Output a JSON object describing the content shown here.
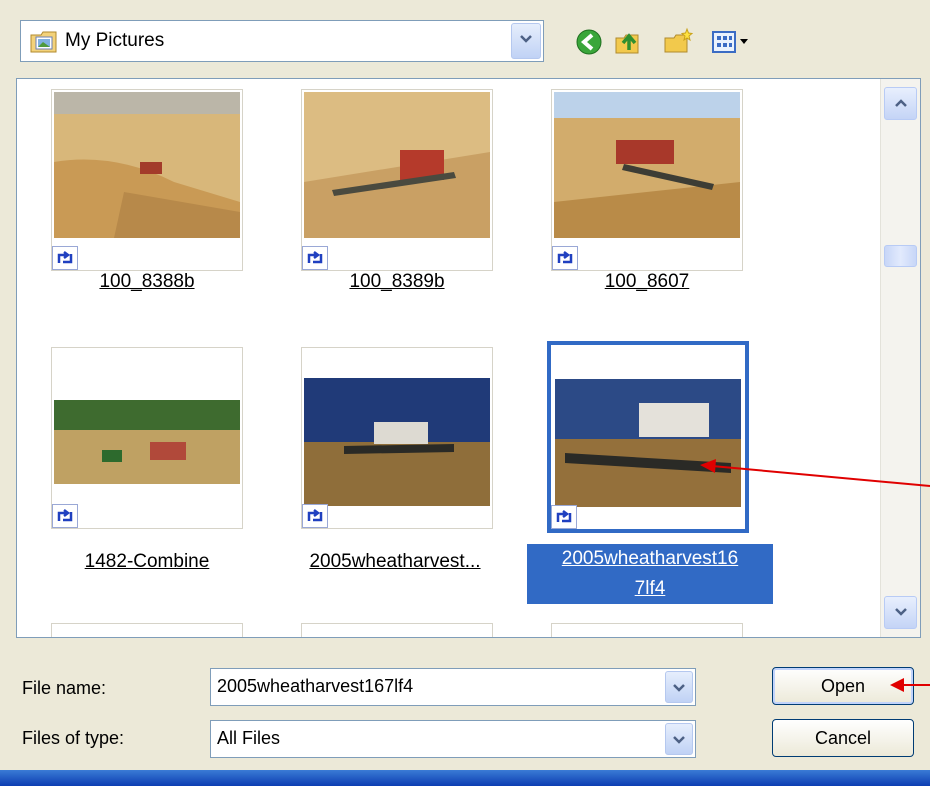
{
  "look_in": {
    "value": "My Pictures"
  },
  "toolbar": {
    "icons": [
      "back-icon",
      "up-folder-icon",
      "new-folder-icon",
      "views-menu-icon"
    ]
  },
  "files": [
    {
      "name": "100_8388b",
      "selected": false
    },
    {
      "name": "100_8389b",
      "selected": false
    },
    {
      "name": "100_8607",
      "selected": false
    },
    {
      "name": "1482-Combine",
      "selected": false
    },
    {
      "name": "2005wheatharvest...",
      "selected": false
    },
    {
      "name": "2005wheatharvest167lf4",
      "name_line1": "2005wheatharvest16",
      "name_line2": "7lf4",
      "selected": true
    }
  ],
  "form": {
    "file_name_label": "File name:",
    "file_name_value": "2005wheatharvest167lf4",
    "file_type_label": "Files of type:",
    "file_type_value": "All Files",
    "open_label": "Open",
    "cancel_label": "Cancel"
  },
  "colors": {
    "selection": "#316ac5",
    "annotation_arrow": "#e00000",
    "dialog_bg": "#ece9d8"
  }
}
